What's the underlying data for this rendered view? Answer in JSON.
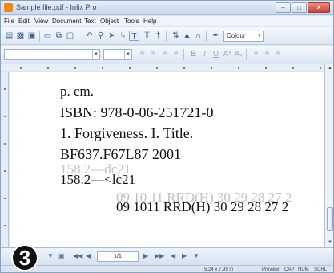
{
  "window": {
    "title": "Sample file.pdf - Infix Pro"
  },
  "menu": [
    "File",
    "Edit",
    "View",
    "Document",
    "Text",
    "Object",
    "Tools",
    "Help"
  ],
  "toolbar": {
    "colour_label": "Colour"
  },
  "document": {
    "lines": [
      "p. cm.",
      "ISBN: 978-0-06-251721-0",
      "1. Forgiveness.  I. Title.",
      "BF637.F67L87  2001",
      "158.2—dc21",
      "158.2—<lc21",
      "09 10 11 RRD(H) 30 29 28 27 2",
      "09  1011 RRD(H) 30 29 28 27 2"
    ]
  },
  "navigation": {
    "page_indicator": "1/1"
  },
  "status": {
    "dimensions": "5.24 x 7.99 in",
    "preview": "Preview",
    "cap": "CAP",
    "num": "NUM",
    "scrl": "SCRL"
  },
  "step_badge": "3"
}
